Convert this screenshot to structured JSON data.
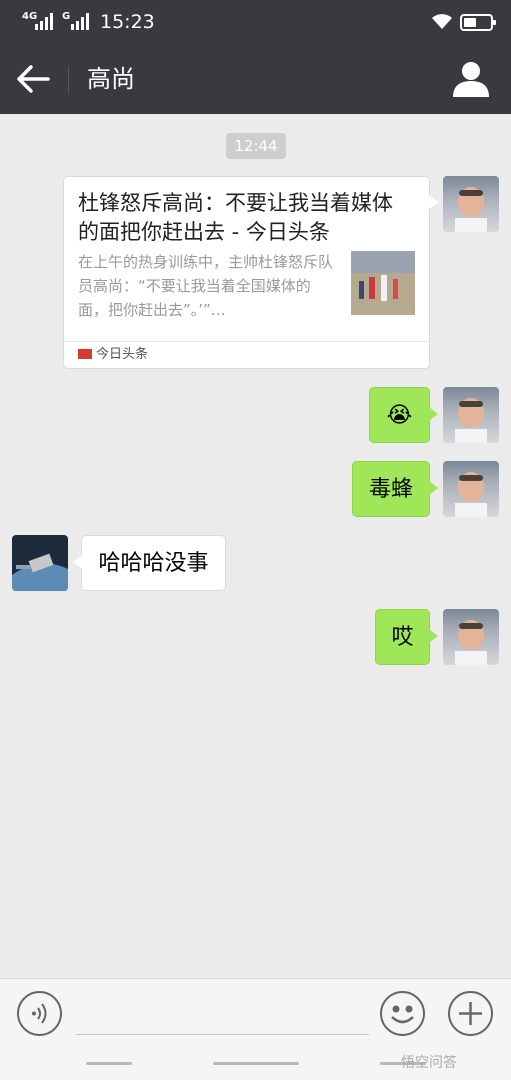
{
  "status_bar": {
    "signal_1_label": "4G",
    "signal_2_label": "G",
    "time": "15:23"
  },
  "header": {
    "title": "高尚",
    "back_icon": "arrow-left-icon",
    "profile_icon": "person-icon"
  },
  "chat": {
    "timestamp": "12:44",
    "article_card": {
      "title": "杜锋怒斥高尚：不要让我当着媒体的面把你赶出去 - 今日头条",
      "description": "在上午的热身训练中，主帅杜锋怒斥队员高尚：“不要让我当着全国媒体的面，把你赶出去”。’”…",
      "source": "今日头条"
    },
    "messages": [
      {
        "side": "right",
        "text": "😭"
      },
      {
        "side": "right",
        "text": "毒蜂"
      },
      {
        "side": "left",
        "text": "哈哈哈没事"
      },
      {
        "side": "right",
        "text": "哎"
      }
    ]
  },
  "input_bar": {
    "voice_icon": "voice-icon",
    "emoji_icon": "smile-icon",
    "plus_icon": "plus-icon"
  },
  "watermark": "悟空问答"
}
